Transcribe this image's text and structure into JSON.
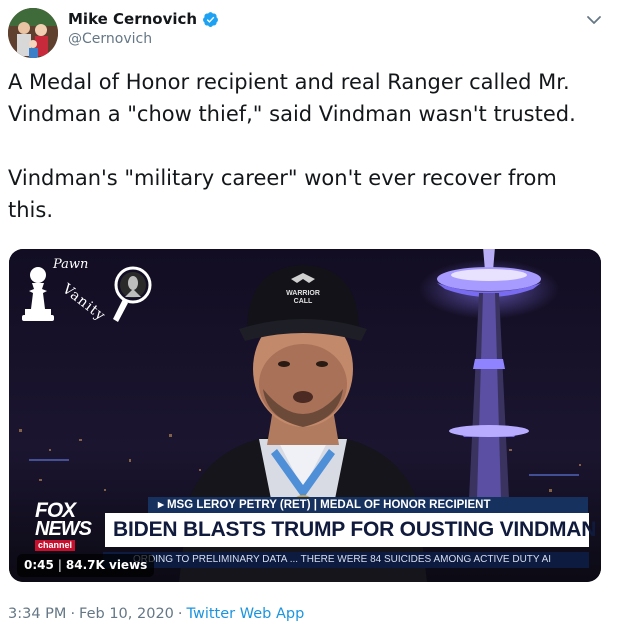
{
  "author": {
    "name": "Mike Cernovich",
    "handle": "@Cernovich",
    "verified": true
  },
  "tweet": {
    "text": "A Medal of Honor recipient and real Ranger called Mr. Vindman a \"chow thief,\" said Vindman wasn't trusted.\n\nVindman's \"military career\" won't ever recover from this."
  },
  "video": {
    "duration": "0:45",
    "views": "84.7K views",
    "watermark": {
      "line1": "Pawn",
      "line2": "Vanity"
    },
    "cap_text": "WARRIOR CALL",
    "broadcast": {
      "network_top": "FOX",
      "network_bottom": "NEWS",
      "network_sub": "channel",
      "strap": "▸ MSG LEROY PETRY (RET) | MEDAL OF HONOR RECIPIENT",
      "headline": "BIDEN BLASTS TRUMP FOR OUSTING VINDMAN",
      "ticker": "ORDING TO PRELIMINARY DATA ...  THERE WERE 84 SUICIDES AMONG ACTIVE DUTY AI"
    }
  },
  "meta": {
    "time": "3:34 PM",
    "date": "Feb 10, 2020",
    "source": "Twitter Web App"
  },
  "colors": {
    "verified": "#1da1f2",
    "link": "#1b95e0",
    "muted": "#657786",
    "fox_blue": "#17315f"
  }
}
